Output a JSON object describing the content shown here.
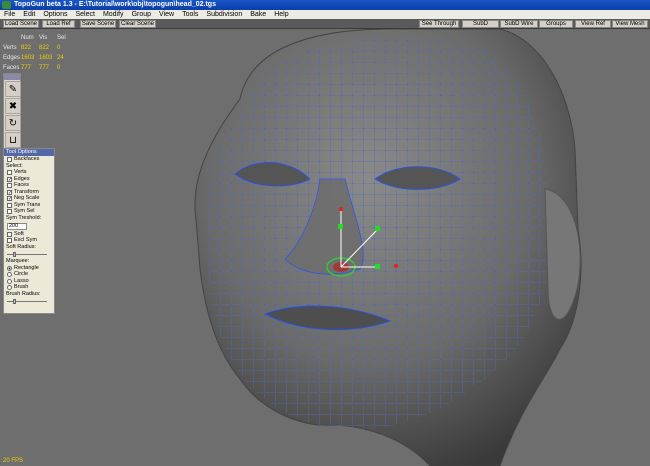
{
  "window": {
    "title": "TopoGun beta 1.3 - E:\\Tutorial\\work\\obj\\topogun\\head_02.tgs"
  },
  "menu": [
    "File",
    "Edit",
    "Options",
    "Select",
    "Modify",
    "Group",
    "View",
    "Tools",
    "Subdivision",
    "Bake",
    "Help"
  ],
  "toolbar": {
    "left": [
      "Load Scene",
      "Load Ref",
      "Save Scene",
      "Clear Scene"
    ],
    "right": [
      "See Through",
      "SubD",
      "SubD Wire",
      "Groups",
      "View Ref",
      "View Mesh"
    ]
  },
  "stats": {
    "headers": [
      "",
      "Num",
      "Vis",
      "Sel"
    ],
    "rows": [
      {
        "label": "Verts",
        "num": "822",
        "vis": "822",
        "sel": "0"
      },
      {
        "label": "Edges",
        "num": "1603",
        "vis": "1603",
        "sel": "24"
      },
      {
        "label": "Faces",
        "num": "777",
        "vis": "777",
        "sel": "0"
      }
    ]
  },
  "tools": {
    "title": "Tools"
  },
  "tool_options": {
    "title": "Tool Options",
    "backfaces": "Backfaces",
    "select_label": "Select:",
    "verts": "Verts",
    "edges": "Edges",
    "faces": "Faces",
    "transform": "Transform",
    "neg_scale": "Neg Scale",
    "sym_trans": "Sym Trans",
    "sym_sel": "Sym Sel",
    "sym_threshold_label": "Sym Treshold:",
    "sym_threshold_value": "200",
    "soft": "Soft",
    "excl_sym": "Excl Sym",
    "soft_radius_label": "Soft Radius:",
    "marquee_label": "Marquee:",
    "rectangle": "Rectangle",
    "circle": "Circle",
    "lasso": "Lasso",
    "brush": "Brush",
    "brush_radius_label": "Brush Radius:"
  },
  "status": {
    "fps": "20 FPS"
  },
  "colors": {
    "title_bar": "#0b3ea8",
    "stat_value": "#f0d000",
    "wire": "#2050ff",
    "gizmo_green": "#22dd22",
    "gizmo_red": "#dd2222"
  }
}
